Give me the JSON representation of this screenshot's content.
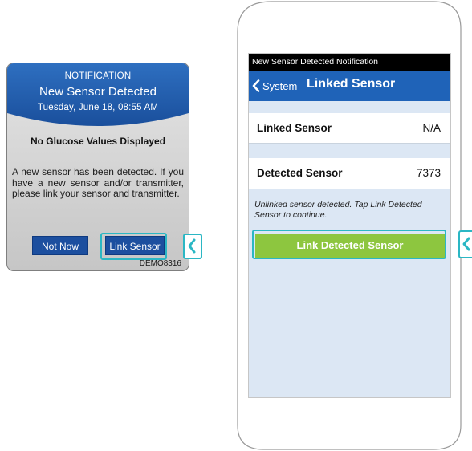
{
  "pump": {
    "header_label": "NOTIFICATION",
    "title": "New Sensor Detected",
    "datetime": "Tuesday, June 18, 08:55 AM",
    "subtitle": "No Glucose Values Displayed",
    "message": "A new sensor has been detected. If you have a new sensor and/or transmitter, please link your sensor and transmitter.",
    "not_now_label": "Not Now",
    "link_sensor_label": "Link Sensor",
    "device_id": "DEMO8316",
    "header_color": "#1f5fb0"
  },
  "phone": {
    "status_text": "New Sensor Detected Notification",
    "back_label": "System",
    "title": "Linked Sensor",
    "linked_sensor_label": "Linked Sensor",
    "linked_sensor_value": "N/A",
    "detected_sensor_label": "Detected Sensor",
    "detected_sensor_value": "7373",
    "info_text": "Unlinked sensor detected. Tap Link Detected Sensor to continue.",
    "link_button_label": "Link Detected Sensor",
    "nav_color": "#1f63b8",
    "button_color": "#8dc63f"
  },
  "highlight": {
    "color": "#2bb7c4",
    "pointer_icon": "chevron-left-icon"
  }
}
